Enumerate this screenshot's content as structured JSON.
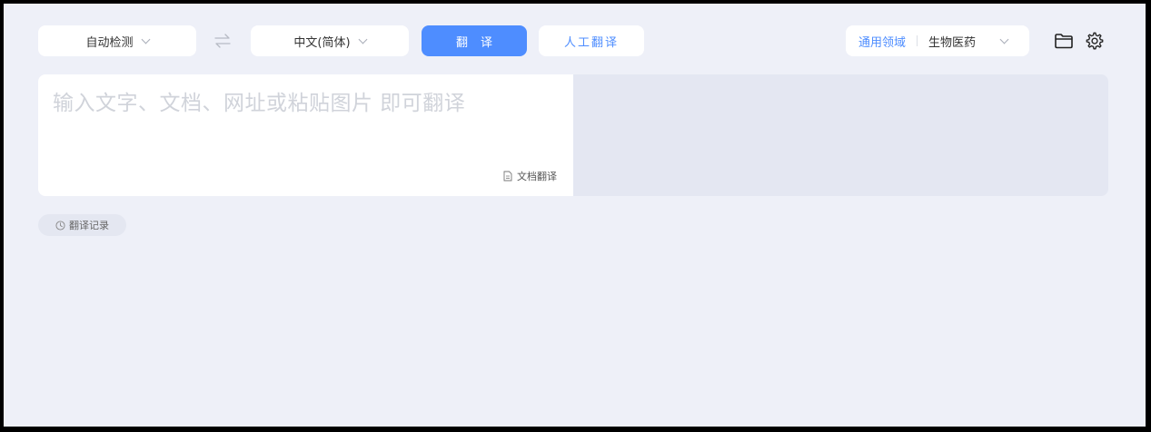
{
  "toolbar": {
    "source_language": "自动检测",
    "target_language": "中文(简体)",
    "translate_label": "翻译",
    "human_translate_label": "人工翻译",
    "domain_general": "通用领域",
    "domain_selected": "生物医药",
    "icons": {
      "swap": "swap-arrows-icon",
      "chevron": "chevron-down-icon",
      "folder": "folder-icon",
      "settings": "gear-icon"
    }
  },
  "input": {
    "placeholder": "输入文字、文档、网址或粘贴图片 即可翻译",
    "doc_translate_label": "文档翻译"
  },
  "history": {
    "label": "翻译记录"
  },
  "colors": {
    "accent": "#4e8dff",
    "background": "#eef0f8",
    "output_panel": "#e4e7f2"
  }
}
